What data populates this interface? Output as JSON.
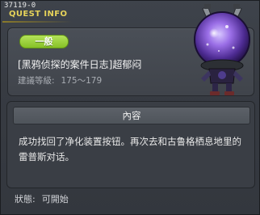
{
  "header": {
    "quest_id": "37119-0",
    "title": "QUEST INFO"
  },
  "quest": {
    "badge": "一般",
    "name": "[黑鸦侦探的案件日志]超郁闷",
    "level_label": "建議等級:",
    "level_value": "175～179"
  },
  "content": {
    "header": "內容",
    "text": "成功找回了净化装置按钮。再次去和古鲁格栖息地里的雷普斯对话。"
  },
  "status": {
    "label": "狀態:",
    "value": "可開始"
  },
  "colors": {
    "title": "#e6d35a",
    "badge": "#9bd13e",
    "panel": "#444950"
  },
  "icons": {
    "npc": "robot-orb-npc-portrait"
  }
}
